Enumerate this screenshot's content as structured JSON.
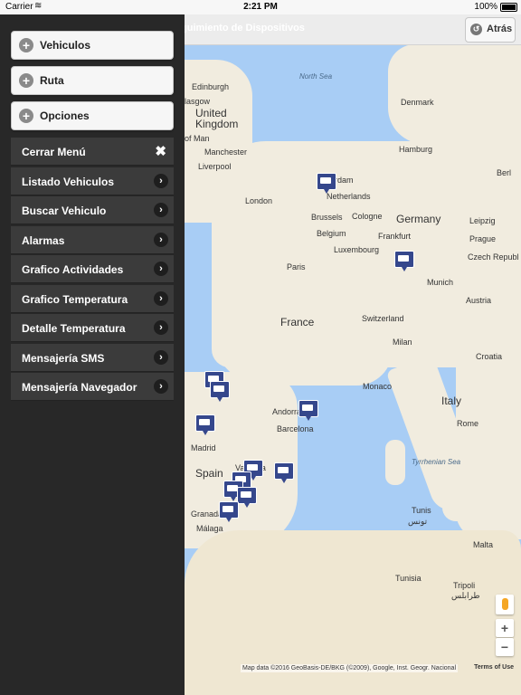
{
  "statusbar": {
    "carrier": "Carrier",
    "time": "2:21 PM",
    "battery": "100%"
  },
  "header": {
    "title": "guimiento de Dispositivos",
    "back_label": "Atrás"
  },
  "menu": {
    "accordion": [
      {
        "label": "Vehiculos"
      },
      {
        "label": "Ruta"
      },
      {
        "label": "Opciones"
      }
    ],
    "close_label": "Cerrar Menú",
    "items": [
      {
        "label": "Listado Vehiculos"
      },
      {
        "label": "Buscar Vehiculo"
      },
      {
        "label": "Alarmas"
      },
      {
        "label": "Grafico Actividades"
      },
      {
        "label": "Grafico Temperatura"
      },
      {
        "label": "Detalle Temperatura"
      },
      {
        "label": "Mensajería SMS"
      },
      {
        "label": "Mensajería Navegador"
      }
    ]
  },
  "map": {
    "labels": {
      "north_sea": "North Sea",
      "edinburgh": "Edinburgh",
      "glasgow": "lasgow",
      "uk": "United",
      "uk2": "Kingdom",
      "isle_of_man": "of Man",
      "manchester": "Manchester",
      "liverpool": "Liverpool",
      "london": "London",
      "denmark": "Denmark",
      "hamburg": "Hamburg",
      "berlin": "Berl",
      "amsterdam": "erdam",
      "netherlands": "Netherlands",
      "brussels": "Brussels",
      "cologne": "Cologne",
      "belgium": "Belgium",
      "germany": "Germany",
      "leipzig": "Leipzig",
      "prague": "Prague",
      "czech": "Czech Republ",
      "frankfurt": "Frankfurt",
      "luxembourg": "Luxembourg",
      "paris": "Paris",
      "munich": "Munich",
      "austria": "Austria",
      "france": "France",
      "switzerland": "Switzerland",
      "milan": "Milan",
      "croatia": "Croatia",
      "monaco": "Monaco",
      "andorra": "Andorra",
      "barcelona": "Barcelona",
      "italy": "Italy",
      "rome": "Rome",
      "madrid": "Madrid",
      "spain": "Spain",
      "valencia": "Valencia",
      "tyrrhenian": "Tyrrhenian Sea",
      "granada": "Granada",
      "malaga": "Málaga",
      "tunis": "Tunis",
      "tunis_ar": "تونس",
      "malta": "Malta",
      "tunisia": "Tunisia",
      "tripoli": "Tripoli",
      "tripoli_ar": "طرابلس"
    },
    "attribution": "Map data ©2016 GeoBasis-DE/BKG (©2009), Google, Inst. Geogr. Nacional",
    "terms": "Terms of Use",
    "zoom_in": "+",
    "zoom_out": "−"
  }
}
